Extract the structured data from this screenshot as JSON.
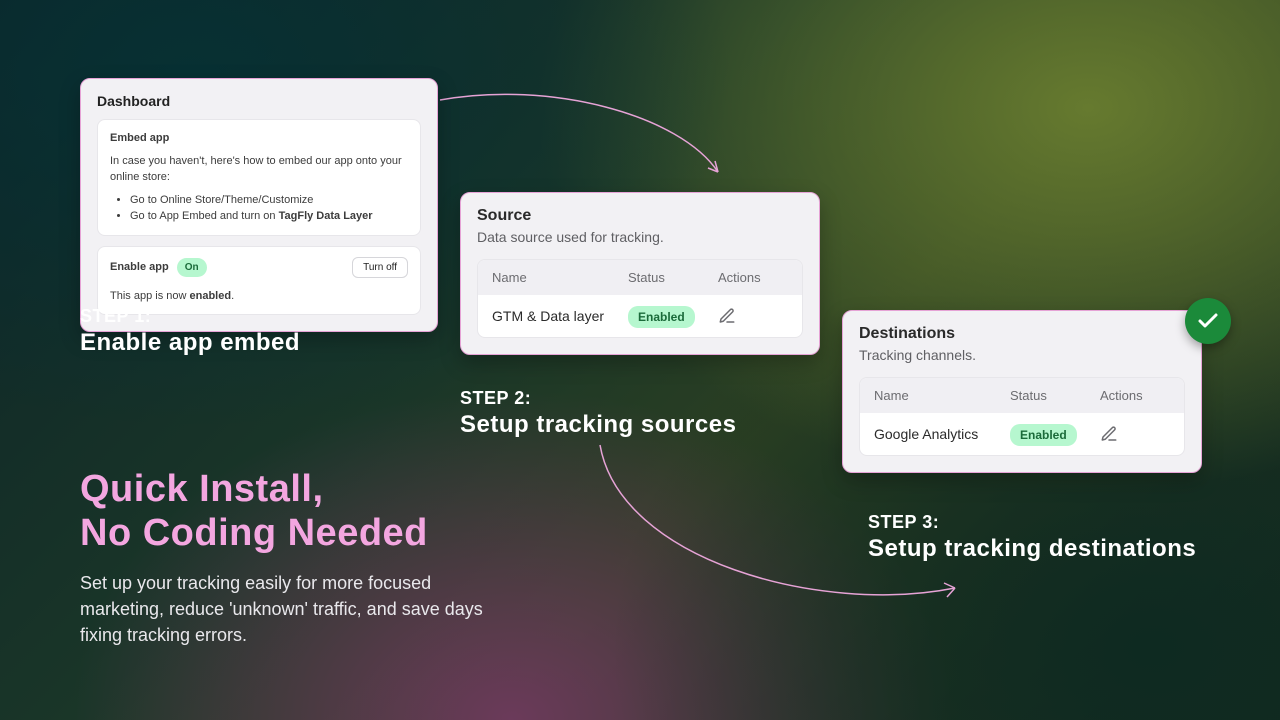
{
  "card1": {
    "title": "Dashboard",
    "embed": {
      "title": "Embed app",
      "intro": "In case you haven't, here's how to embed our app onto your online store:",
      "bullet1": "Go to Online Store/Theme/Customize",
      "bullet2_prefix": "Go to App Embed and turn on ",
      "bullet2_bold": "TagFly Data Layer"
    },
    "enable": {
      "label": "Enable app",
      "pill": "On",
      "turn_off": "Turn off",
      "note_prefix": "This app is now ",
      "note_bold": "enabled",
      "note_suffix": "."
    }
  },
  "card2": {
    "title": "Source",
    "subtitle": "Data source used for tracking.",
    "headers": {
      "name": "Name",
      "status": "Status",
      "actions": "Actions"
    },
    "row": {
      "name": "GTM & Data layer",
      "status": "Enabled"
    }
  },
  "card3": {
    "title": "Destinations",
    "subtitle": "Tracking channels.",
    "headers": {
      "name": "Name",
      "status": "Status",
      "actions": "Actions"
    },
    "row": {
      "name": "Google Analytics",
      "status": "Enabled"
    }
  },
  "steps": {
    "s1a": "STEP 1:",
    "s1b": "Enable app embed",
    "s2a": "STEP 2:",
    "s2b": "Setup tracking sources",
    "s3a": "STEP 3:",
    "s3b": "Setup tracking destinations"
  },
  "hero": {
    "headline_l1": "Quick Install,",
    "headline_l2": "No Coding Needed",
    "subtext": "Set up your tracking easily for more focused marketing, reduce 'unknown' traffic, and save days fixing tracking errors."
  }
}
